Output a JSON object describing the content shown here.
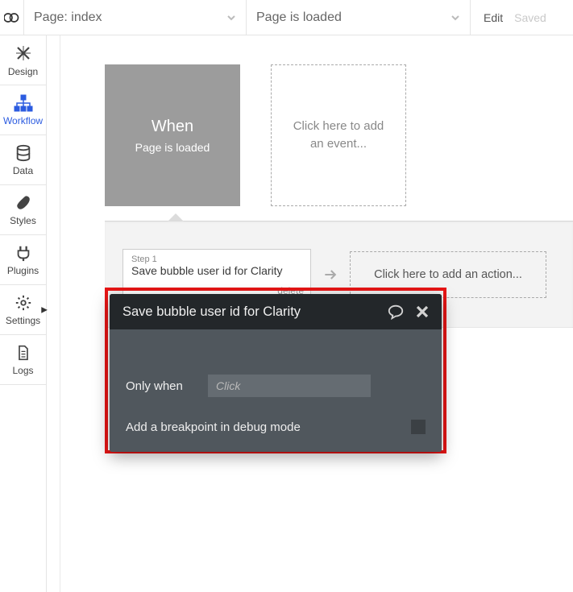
{
  "topbar": {
    "page_dropdown_label": "Page: index",
    "event_dropdown_label": "Page is loaded",
    "edit_label": "Edit",
    "saved_label": "Saved"
  },
  "sidebar": {
    "items": {
      "design": "Design",
      "workflow": "Workflow",
      "data": "Data",
      "styles": "Styles",
      "plugins": "Plugins",
      "settings": "Settings",
      "logs": "Logs"
    }
  },
  "events": {
    "when_label": "When",
    "when_desc": "Page is loaded",
    "add_event_label": "Click here to add an event..."
  },
  "steps": {
    "step1_label": "Step 1",
    "step1_title": "Save bubble user id for Clarity",
    "delete_label": "delete",
    "add_action_label": "Click here to add an action..."
  },
  "panel": {
    "title": "Save bubble user id for Clarity",
    "only_when_label": "Only when",
    "only_when_placeholder": "Click",
    "breakpoint_label": "Add a breakpoint in debug mode"
  }
}
